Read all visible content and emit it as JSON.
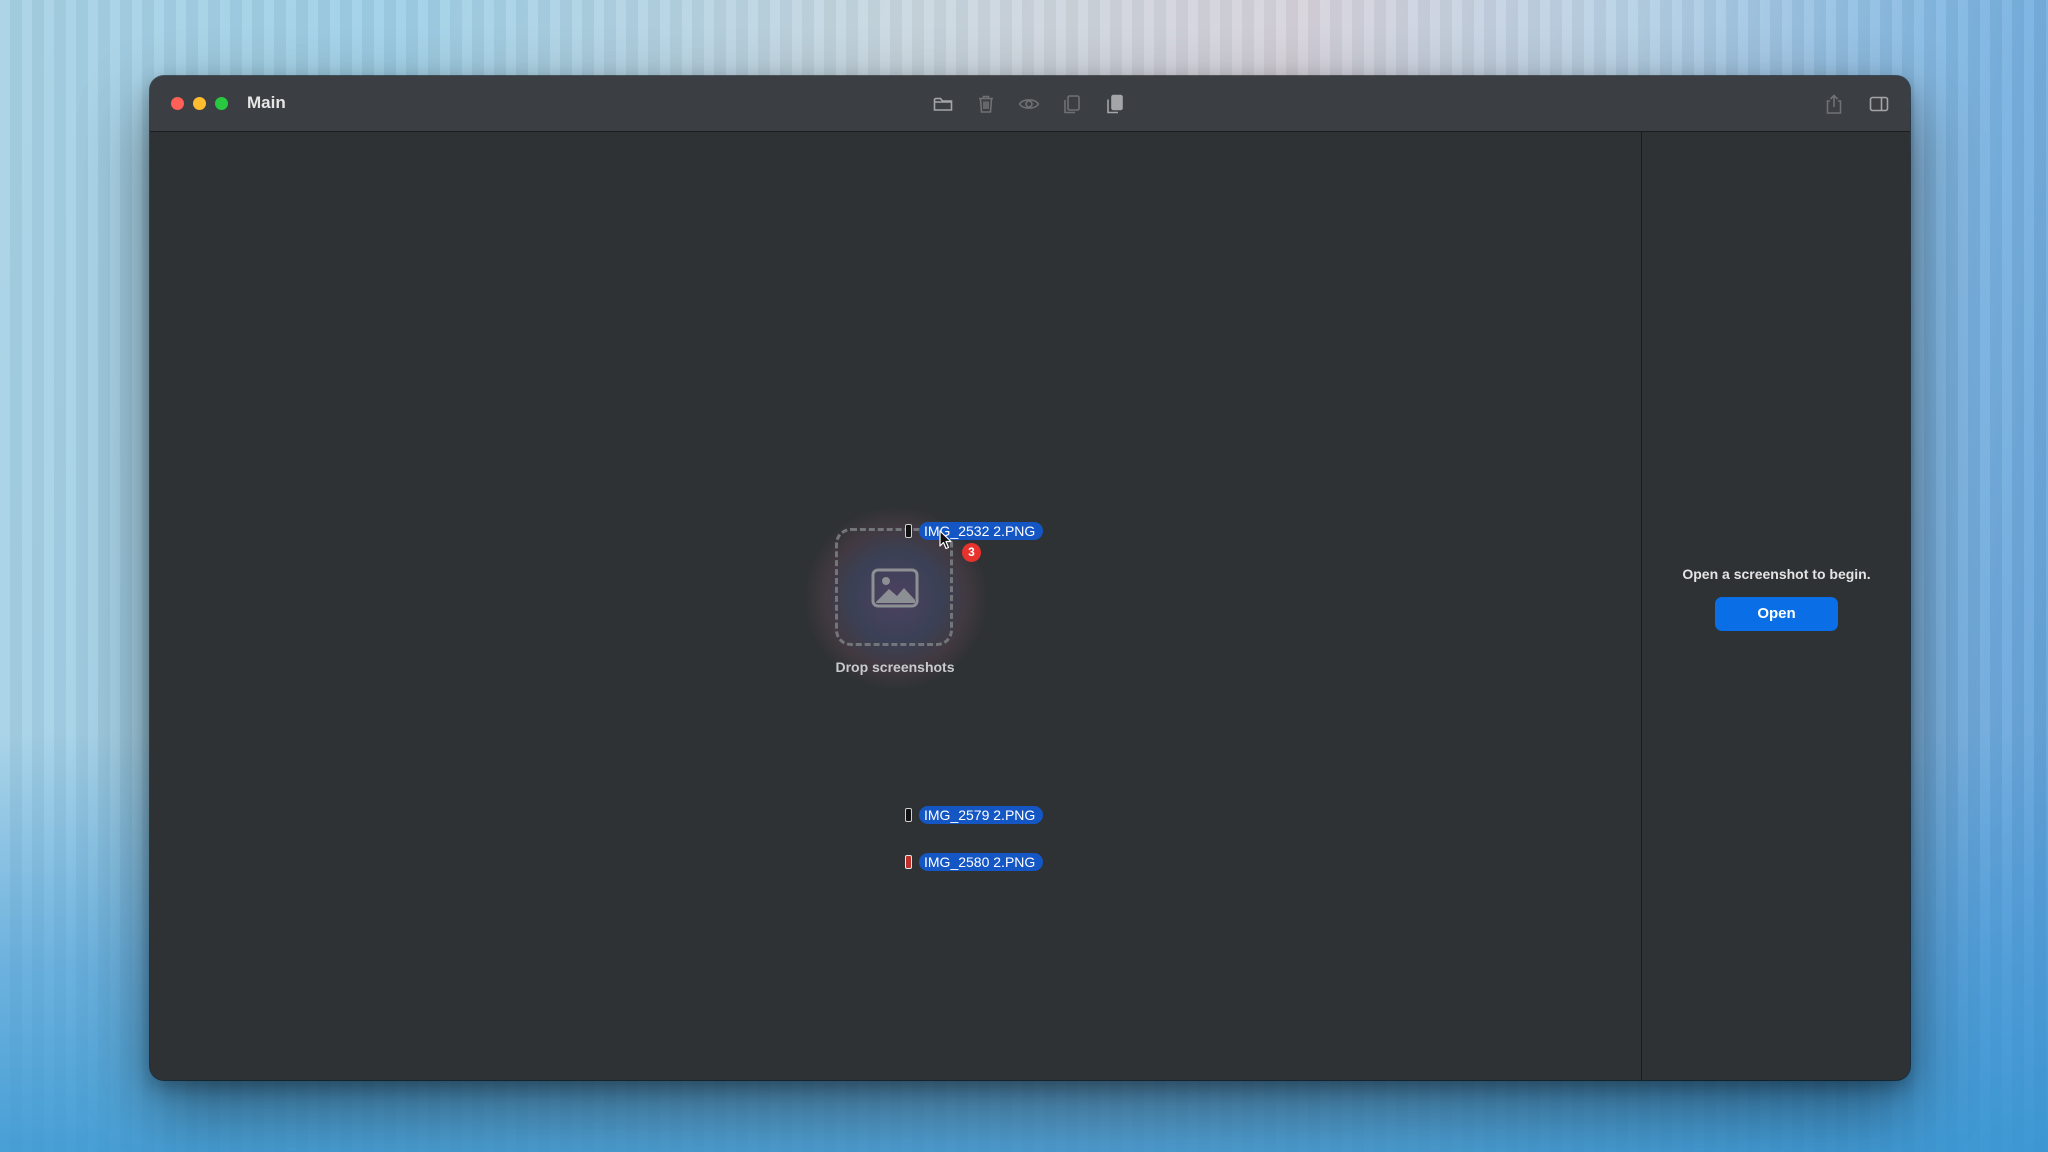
{
  "window": {
    "title": "Main"
  },
  "toolbar": {
    "buttons": [
      {
        "name": "folder-icon",
        "label": "Open folder"
      },
      {
        "name": "trash-icon",
        "label": "Delete"
      },
      {
        "name": "eye-icon",
        "label": "Preview"
      },
      {
        "name": "copy-icon",
        "label": "Copy"
      },
      {
        "name": "paste-icon",
        "label": "Paste"
      }
    ],
    "right_buttons": [
      {
        "name": "share-icon"
      },
      {
        "name": "sidebar-toggle-icon"
      }
    ]
  },
  "drop_zone": {
    "label": "Drop screenshots",
    "icon": "image-icon"
  },
  "drag": {
    "count_badge": "3",
    "files": [
      {
        "name": "IMG_2532 2.PNG",
        "thumb": "dark"
      },
      {
        "name": "IMG_2579 2.PNG",
        "thumb": "dark"
      },
      {
        "name": "IMG_2580 2.PNG",
        "thumb": "red"
      }
    ]
  },
  "inspector": {
    "message": "Open a screenshot to begin.",
    "open_button": "Open"
  },
  "colors": {
    "accent": "#0a6fe6",
    "selection": "#1456c4",
    "badge": "#e8322d",
    "window_bg": "#2f3235",
    "titlebar_bg": "#3b3e42"
  }
}
